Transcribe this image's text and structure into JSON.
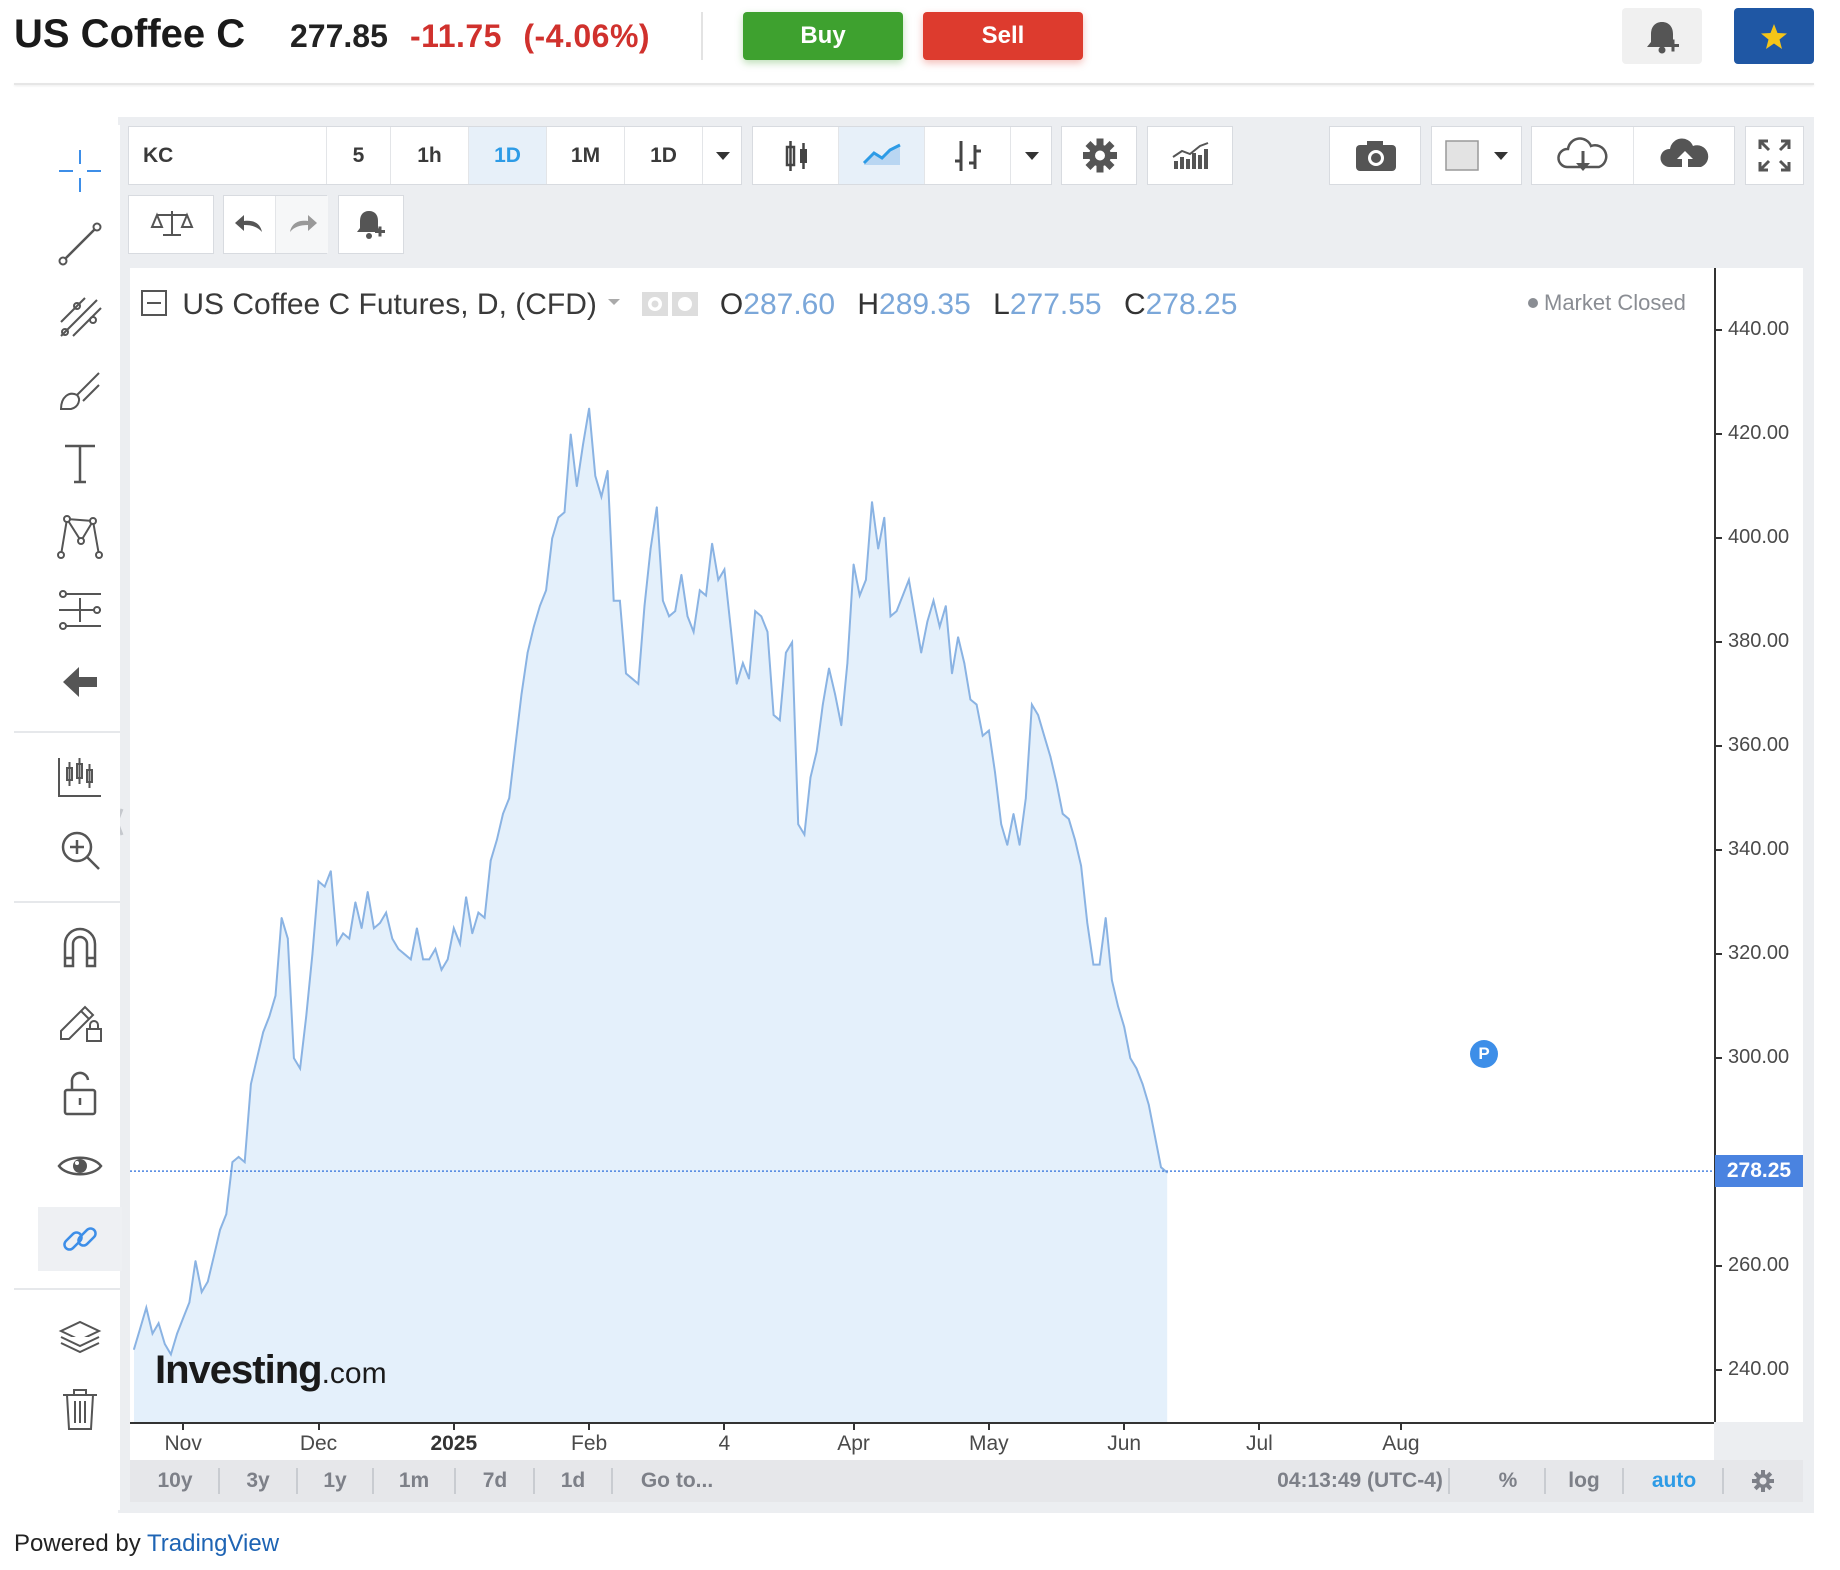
{
  "header": {
    "title": "US Coffee C",
    "price": "277.85",
    "change": "-11.75",
    "change_pct": "(-4.06%)",
    "buy_label": "Buy",
    "sell_label": "Sell"
  },
  "toolbar": {
    "symbol": "KC",
    "intervals": [
      "5",
      "1h",
      "1D",
      "1M",
      "1D"
    ],
    "active_interval": "1D"
  },
  "legend": {
    "name": "US Coffee C Futures, D, (CFD)",
    "o_label": "O",
    "o": "287.60",
    "h_label": "H",
    "h": "289.35",
    "l_label": "L",
    "l": "277.55",
    "c_label": "C",
    "c": "278.25",
    "status": "Market Closed"
  },
  "price_tag": "278.25",
  "badge": "P",
  "watermark": {
    "brand": "Investing",
    "suffix": ".com"
  },
  "ranges": [
    "10y",
    "3y",
    "1y",
    "1m",
    "7d",
    "1d",
    "Go to..."
  ],
  "bottom_right": {
    "time": "04:13:49 (UTC-4)",
    "percent": "%",
    "log": "log",
    "auto": "auto"
  },
  "powered": {
    "prefix": "Powered by ",
    "link": "TradingView"
  },
  "colors": {
    "line": "#8ab3e3",
    "fill": "#e4f0fb",
    "accent": "#2d9be6",
    "buy": "#3ea12f",
    "sell": "#dd3b2e"
  },
  "chart_data": {
    "type": "area",
    "title": "US Coffee C Futures, D, (CFD)",
    "y_ticks": [
      "440.00",
      "420.00",
      "400.00",
      "380.00",
      "360.00",
      "340.00",
      "320.00",
      "300.00",
      "260.00",
      "240.00"
    ],
    "ylim": [
      230,
      452
    ],
    "x_ticks": [
      {
        "label": "Nov",
        "idx": 8,
        "bold": false
      },
      {
        "label": "Dec",
        "idx": 30,
        "bold": false
      },
      {
        "label": "2025",
        "idx": 52,
        "bold": true
      },
      {
        "label": "Feb",
        "idx": 74,
        "bold": false
      },
      {
        "label": "4",
        "idx": 96,
        "bold": false
      },
      {
        "label": "Apr",
        "idx": 117,
        "bold": false
      },
      {
        "label": "May",
        "idx": 139,
        "bold": false
      },
      {
        "label": "Jun",
        "idx": 161,
        "bold": false
      },
      {
        "label": "Jul",
        "idx": 183,
        "bold": false
      },
      {
        "label": "Aug",
        "idx": 206,
        "bold": false
      }
    ],
    "x_total": 215,
    "series": [
      {
        "values": [
          244,
          248,
          252,
          247,
          249,
          245,
          243,
          247,
          250,
          253,
          261,
          255,
          257,
          262,
          267,
          270,
          280,
          281,
          280,
          295,
          300,
          305,
          308,
          312,
          327,
          323,
          300,
          298,
          308,
          320,
          334,
          333,
          336,
          322,
          324,
          323,
          330,
          325,
          332,
          325,
          326,
          328,
          323,
          321,
          320,
          319,
          325,
          319,
          319,
          321,
          317,
          319,
          325,
          322,
          331,
          324,
          328,
          327,
          338,
          342,
          347,
          350,
          360,
          370,
          378,
          383,
          387,
          390,
          400,
          404,
          405,
          420,
          410,
          418,
          425,
          412,
          408,
          413,
          388,
          388,
          374,
          373,
          372,
          387,
          398,
          406,
          388,
          385,
          386,
          393,
          385,
          382,
          390,
          389,
          399,
          392,
          394,
          383,
          372,
          376,
          373,
          386,
          385,
          382,
          366,
          365,
          378,
          380,
          345,
          343,
          354,
          359,
          368,
          375,
          370,
          364,
          376,
          395,
          389,
          392,
          407,
          398,
          404,
          385,
          386,
          389,
          392,
          385,
          378,
          384,
          388,
          383,
          387,
          374,
          381,
          376,
          369,
          368,
          362,
          363,
          355,
          345,
          341,
          347,
          341,
          350,
          368,
          366,
          362,
          358,
          353,
          347,
          346,
          342,
          337,
          326,
          318,
          318,
          327,
          315,
          310,
          306,
          300,
          298,
          295,
          291,
          285,
          279,
          278
        ]
      }
    ]
  }
}
